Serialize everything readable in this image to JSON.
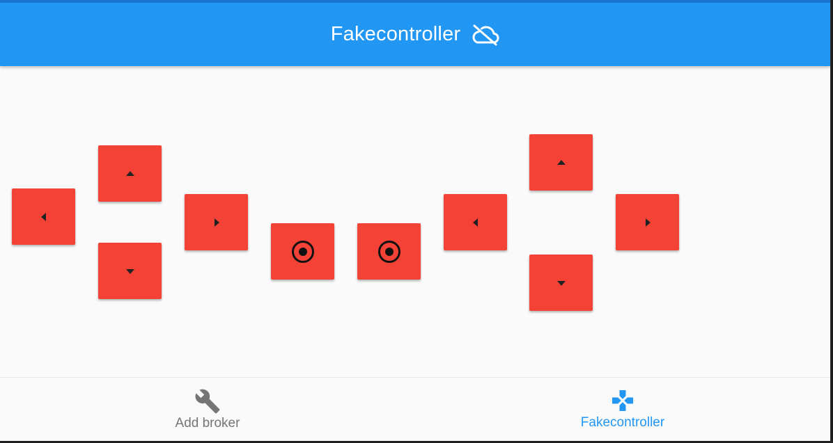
{
  "app": {
    "title": "Fakecontroller",
    "status_icon": "cloud-off-icon",
    "colors": {
      "primary": "#2196f3",
      "pad": "#f44336",
      "background": "#fafafa",
      "inactive": "#757575"
    }
  },
  "controller": {
    "left_dpad": {
      "up": "arrow-up-icon",
      "down": "arrow-down-icon",
      "left": "arrow-left-icon",
      "right": "arrow-right-icon"
    },
    "center_buttons": [
      "radio-button-icon",
      "radio-button-icon"
    ],
    "right_dpad": {
      "up": "arrow-up-icon",
      "down": "arrow-down-icon",
      "left": "arrow-left-icon",
      "right": "arrow-right-icon"
    }
  },
  "bottom_nav": {
    "items": [
      {
        "label": "Add broker",
        "icon": "wrench-icon",
        "active": false
      },
      {
        "label": "Fakecontroller",
        "icon": "gamepad-icon",
        "active": true
      }
    ]
  }
}
